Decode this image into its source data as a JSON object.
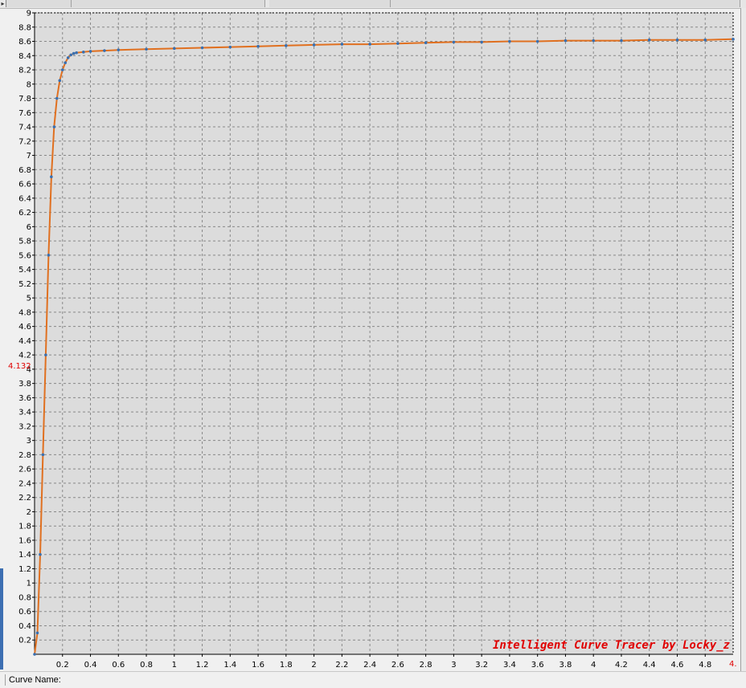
{
  "window": {
    "status_label": "Curve Name:",
    "scroll_arrow_glyph": "▸"
  },
  "chart_data": {
    "type": "line",
    "watermark": "Intelligent Curve Tracer by Locky_z",
    "xlim": [
      0,
      5
    ],
    "ylim": [
      0,
      9
    ],
    "x_ticks": [
      "0.2",
      "0.4",
      "0.6",
      "0.8",
      "1",
      "1.2",
      "1.4",
      "1.6",
      "1.8",
      "2",
      "2.2",
      "2.4",
      "2.6",
      "2.8",
      "3",
      "3.2",
      "3.4",
      "3.6",
      "3.8",
      "4",
      "4.2",
      "4.4",
      "4.6",
      "4.8"
    ],
    "y_ticks": [
      "0.2",
      "0.4",
      "0.6",
      "0.8",
      "1",
      "1.2",
      "1.4",
      "1.6",
      "1.8",
      "2",
      "2.2",
      "2.4",
      "2.6",
      "2.8",
      "3",
      "3.2",
      "3.4",
      "3.6",
      "3.8",
      "4",
      "4.2",
      "4.4",
      "4.6",
      "4.8",
      "5",
      "5.2",
      "5.4",
      "5.6",
      "5.8",
      "6",
      "6.2",
      "6.4",
      "6.6",
      "6.8",
      "7",
      "7.2",
      "7.4",
      "7.6",
      "7.8",
      "8",
      "8.2",
      "8.4",
      "8.6",
      "8.8",
      "9"
    ],
    "grid": true,
    "cursor": {
      "y_value_label": "4.132",
      "x_value_label": "4."
    },
    "line_color": "#e07020",
    "marker_color": "#3a70b0",
    "grid_color": "#888888",
    "plot_background": "#dcdcdc",
    "series": [
      {
        "x": [
          0,
          0.02,
          0.04,
          0.06,
          0.08,
          0.1,
          0.12,
          0.14,
          0.16,
          0.18,
          0.2,
          0.22,
          0.24,
          0.26,
          0.28,
          0.3,
          0.35,
          0.4,
          0.5,
          0.6,
          0.8,
          1.0,
          1.2,
          1.4,
          1.6,
          1.8,
          2.0,
          2.2,
          2.4,
          2.6,
          2.8,
          3.0,
          3.2,
          3.4,
          3.6,
          3.8,
          4.0,
          4.2,
          4.4,
          4.6,
          4.8,
          5.0
        ],
        "y": [
          0,
          0.3,
          1.4,
          2.8,
          4.2,
          5.6,
          6.7,
          7.4,
          7.8,
          8.05,
          8.2,
          8.3,
          8.37,
          8.41,
          8.43,
          8.44,
          8.45,
          8.46,
          8.47,
          8.48,
          8.49,
          8.5,
          8.51,
          8.52,
          8.53,
          8.54,
          8.55,
          8.56,
          8.56,
          8.57,
          8.58,
          8.59,
          8.59,
          8.6,
          8.6,
          8.61,
          8.61,
          8.61,
          8.62,
          8.62,
          8.62,
          8.63
        ]
      }
    ]
  }
}
